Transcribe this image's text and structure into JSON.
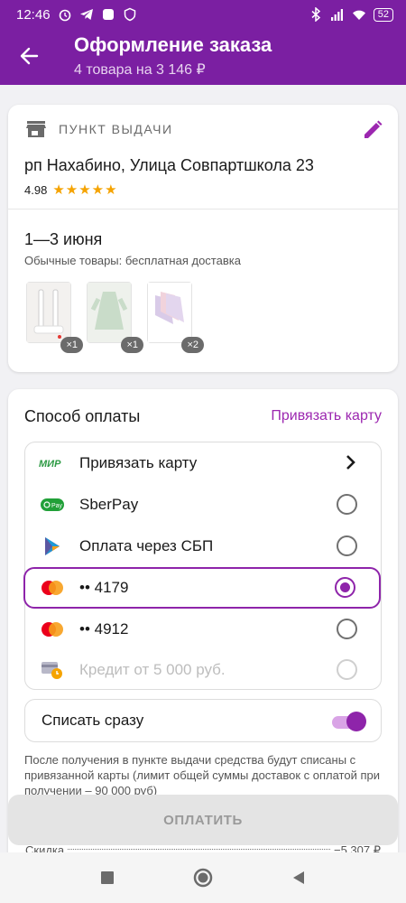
{
  "status_bar": {
    "time": "12:46",
    "battery": "52",
    "left_icons": [
      "alarm-icon",
      "telegram-icon",
      "square-app-icon",
      "shield-icon"
    ],
    "right_icons": [
      "bluetooth-icon",
      "signal-icon",
      "wifi-icon",
      "battery-icon"
    ]
  },
  "header": {
    "title": "Оформление заказа",
    "subtitle": "4 товара на 3 146 ₽"
  },
  "pickup": {
    "label": "ПУНКТ ВЫДАЧИ",
    "address": "рп Нахабино, Улица Совпартшкола 23",
    "rating": "4.98",
    "stars": "★★★★★",
    "rating_stars": 5,
    "dates": "1—3 июня",
    "delivery_note": "Обычные товары: бесплатная доставка",
    "items": [
      {
        "name": "toothbrush-thumbnail",
        "qty": "×1"
      },
      {
        "name": "dress-thumbnail",
        "qty": "×1"
      },
      {
        "name": "socks-thumbnail",
        "qty": "×2"
      }
    ]
  },
  "payment": {
    "title": "Способ оплаты",
    "bind_link": "Привязать карту",
    "options": [
      {
        "label": "Привязать карту",
        "icon": "mir-icon",
        "control": "chevron"
      },
      {
        "label": "SberPay",
        "icon": "sberpay-icon",
        "control": "radio"
      },
      {
        "label": "Оплата через СБП",
        "icon": "sbp-icon",
        "control": "radio"
      },
      {
        "label": "•• 4179",
        "icon": "mastercard-icon",
        "control": "radio",
        "selected": true
      },
      {
        "label": "•• 4912",
        "icon": "mastercard-icon",
        "control": "radio"
      },
      {
        "label": "Кредит от 5 000 руб.",
        "icon": "credit-icon",
        "control": "radio",
        "disabled": true
      }
    ],
    "charge_now_label": "Списать сразу",
    "charge_now_enabled": true,
    "info": "После получения в пункте выдачи средства будут списаны с привязанной карты (лимит общей суммы доставок с оплатой при получении – 90 000 руб)"
  },
  "pay_button": "ОПЛАТИТЬ",
  "summary": {
    "discount_label": "Скидка",
    "discount_value": "−5 307 ₽"
  },
  "colors": {
    "brand": "#7b1fa2",
    "accent": "#8e24aa",
    "star": "#f5a300"
  }
}
